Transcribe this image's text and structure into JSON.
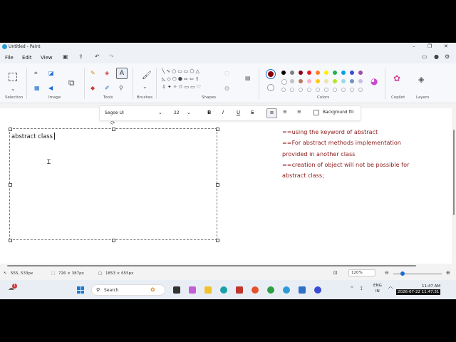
{
  "window": {
    "title": "Untitled - Paint",
    "controls": [
      "–",
      "❐",
      "✕"
    ]
  },
  "menu": {
    "file": "File",
    "edit": "Edit",
    "view": "View"
  },
  "ribbon": {
    "groups": {
      "selection": "Selection",
      "image": "Image",
      "tools": "Tools",
      "brushes": "Brushes",
      "shapes": "Shapes",
      "colors": "Colors",
      "copilot": "Copilot",
      "layers": "Layers"
    },
    "active_color": "#8b0000",
    "palette_row1": [
      "#000000",
      "#7f7f7f",
      "#880015",
      "#ed1c24",
      "#ff7f27",
      "#fff200",
      "#22b14c",
      "#00a2e8",
      "#3f48cc",
      "#a349a4"
    ],
    "palette_row2": [
      "#ffffff",
      "#c3c3c3",
      "#b97a57",
      "#ffaec9",
      "#ffc90e",
      "#efe4b0",
      "#b5e61d",
      "#99d9ea",
      "#7092be",
      "#c8bfe7"
    ]
  },
  "text_toolbar": {
    "font": "Segoe UI",
    "size": "22",
    "bold": "B",
    "italic": "I",
    "underline": "U",
    "strike": "S",
    "background_fill": "Background fill"
  },
  "canvas": {
    "typed_text": "abstract class",
    "notes": [
      "==using the keyword of abstract",
      "==For abstract methods implementation",
      "provided in another class",
      "==creation of object will not be possible for",
      "abstract class;"
    ],
    "notes_color": "#8b1a1a"
  },
  "status": {
    "cursor_pos": "555, 533px",
    "selection_size": "726 × 387px",
    "canvas_size": "1853 × 655px",
    "zoom": "120%"
  },
  "taskbar": {
    "search_placeholder": "Search",
    "lang_top": "ENG",
    "lang_bottom": "IN",
    "time": "11:47 AM",
    "datetime_overlay": "2026-07-22 11:47:31",
    "notification_count": "1"
  }
}
